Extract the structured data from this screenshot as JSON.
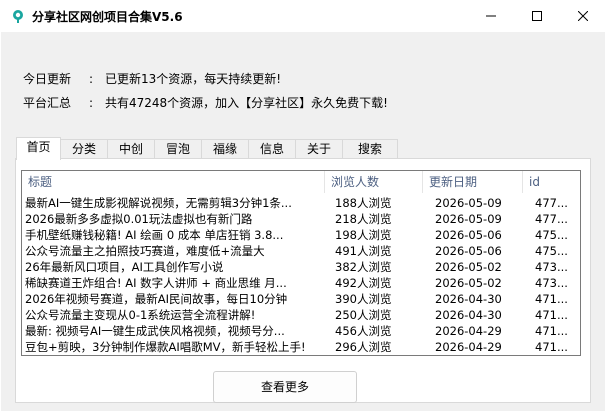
{
  "window": {
    "title": "分享社区网创项目合集V5.6"
  },
  "info": {
    "update_label": "今日更新",
    "update_value": "已更新13个资源，每天持续更新!",
    "summary_label": "平台汇总",
    "summary_value": "共有47248个资源，加入【分享社区】永久免费下载!",
    "colon": ":"
  },
  "tabs": [
    {
      "label": "首页",
      "active": true
    },
    {
      "label": "分类"
    },
    {
      "label": "中创"
    },
    {
      "label": "冒泡"
    },
    {
      "label": "福缘"
    },
    {
      "label": "信息"
    },
    {
      "label": "关于"
    },
    {
      "label": "搜索"
    }
  ],
  "table": {
    "columns": [
      "标题",
      "浏览人数",
      "更新日期",
      "id"
    ],
    "rows": [
      [
        "最新AI一键生成影视解说视频，无需剪辑3分钟1条...",
        "188人浏览",
        "2026-05-09",
        "477..."
      ],
      [
        "2026最新多多虚拟0.01玩法虚拟也有新门路",
        "218人浏览",
        "2026-05-09",
        "477..."
      ],
      [
        "手机壁纸赚钱秘籍! AI 绘画 0 成本 单店狂销 3.8...",
        "198人浏览",
        "2026-05-06",
        "475..."
      ],
      [
        "公众号流量主之拍照技巧赛道，难度低+流量大",
        "491人浏览",
        "2026-05-06",
        "475..."
      ],
      [
        "26年最新风口项目，AI工具创作写小说",
        "382人浏览",
        "2026-05-02",
        "473..."
      ],
      [
        "稀缺赛道王炸组合! AI 数字人讲师 + 商业思维 月...",
        "492人浏览",
        "2026-05-02",
        "473..."
      ],
      [
        "2026年视频号赛道，最新AI民间故事，每日10分钟",
        "390人浏览",
        "2026-04-30",
        "471..."
      ],
      [
        "公众号流量主变现从0-1系统运营全流程讲解!",
        "250人浏览",
        "2026-04-30",
        "471..."
      ],
      [
        "最新: 视频号AI一键生成武侠风格视频，视频号分...",
        "456人浏览",
        "2026-04-29",
        "471..."
      ],
      [
        "豆包+剪映，3分钟制作爆款AI唱歌MV，新手轻松上手!",
        "296人浏览",
        "2026-04-29",
        "471..."
      ]
    ]
  },
  "buttons": {
    "more": "查看更多"
  },
  "colors": {
    "header_text": "#4d6082",
    "client_bg": "#f0f0f0",
    "list_border": "#7a7a7a"
  }
}
